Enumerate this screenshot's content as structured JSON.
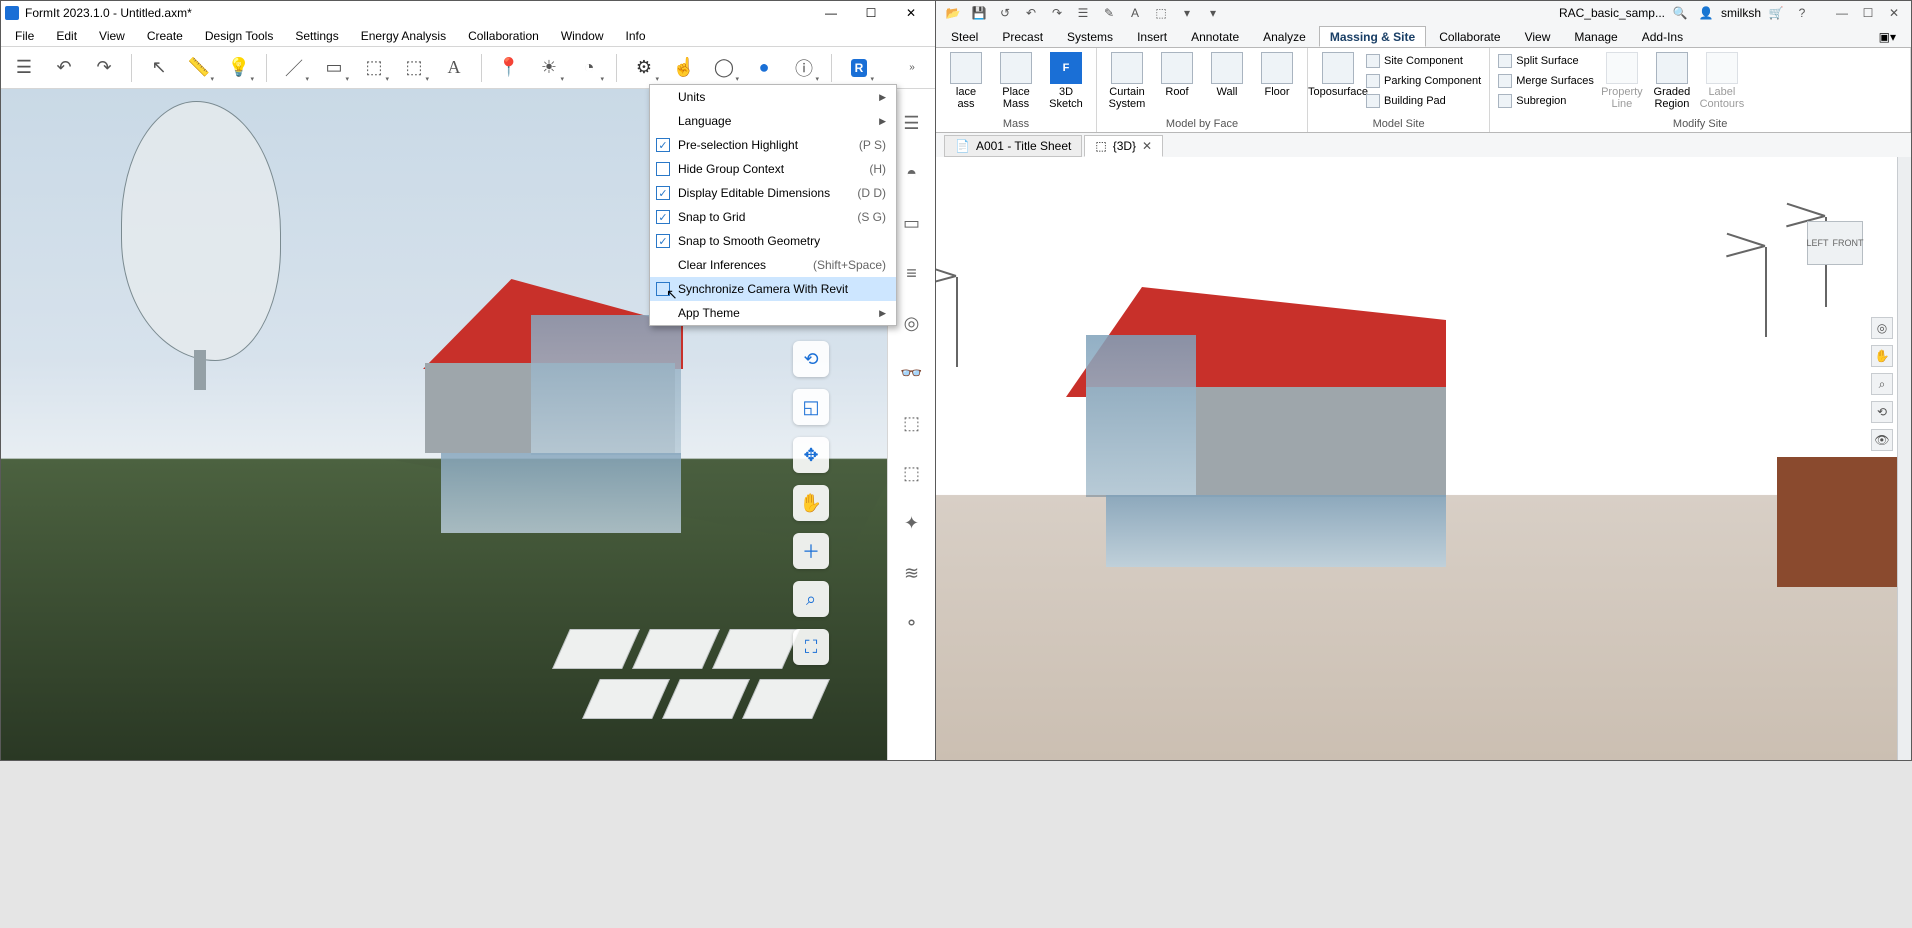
{
  "formit": {
    "title": "FormIt 2023.1.0 - Untitled.axm*",
    "menu": [
      "File",
      "Edit",
      "View",
      "Create",
      "Design Tools",
      "Settings",
      "Energy Analysis",
      "Collaboration",
      "Window",
      "Info"
    ],
    "dropdown": {
      "items": [
        {
          "label": "Units",
          "submenu": true
        },
        {
          "label": "Language",
          "submenu": true
        },
        {
          "label": "Pre-selection Highlight",
          "checked": true,
          "shortcut": "(P S)"
        },
        {
          "label": "Hide Group Context",
          "checked": false,
          "shortcut": "(H)"
        },
        {
          "label": "Display Editable Dimensions",
          "checked": true,
          "shortcut": "(D D)"
        },
        {
          "label": "Snap to Grid",
          "checked": true,
          "shortcut": "(S G)"
        },
        {
          "label": "Snap to Smooth Geometry",
          "checked": true
        },
        {
          "label": "Clear Inferences",
          "shortcut": "(Shift+Space)"
        },
        {
          "label": "Synchronize Camera With Revit",
          "checked": false,
          "highlight": true
        },
        {
          "label": "App Theme",
          "submenu": true
        }
      ]
    }
  },
  "revit": {
    "doc": "RAC_basic_samp...",
    "user": "smilksh",
    "tabs": [
      "Steel",
      "Precast",
      "Systems",
      "Insert",
      "Annotate",
      "Analyze",
      "Massing & Site",
      "Collaborate",
      "View",
      "Manage",
      "Add-Ins"
    ],
    "active_tab": "Massing & Site",
    "panels": {
      "mass_big": [
        [
          "place",
          "Place\nMass"
        ],
        [
          "3d",
          "3D\nSketch"
        ]
      ],
      "mass_title": "Mass",
      "face_big": [
        [
          "curtain",
          "Curtain\nSystem"
        ],
        [
          "roof",
          "Roof"
        ],
        [
          "wall",
          "Wall"
        ],
        [
          "floor",
          "Floor"
        ]
      ],
      "face_title": "Model by Face",
      "topo_big": [
        [
          "topo",
          "Toposurface"
        ]
      ],
      "site_items": [
        "Site Component",
        "Parking Component",
        "Building Pad"
      ],
      "site_title": "Model Site",
      "modify_right_big": [
        [
          "propline",
          "Property\nLine"
        ],
        [
          "graded",
          "Graded\nRegion"
        ],
        [
          "labelc",
          "Label\nContours"
        ]
      ],
      "modify_items": [
        "Split Surface",
        "Merge Surfaces",
        "Subregion"
      ],
      "modify_title": "Modify Site"
    },
    "view_tabs": [
      {
        "label": "A001 - Title Sheet",
        "active": false,
        "closable": false
      },
      {
        "label": "{3D}",
        "active": true,
        "closable": true
      }
    ],
    "viewcube": [
      "LEFT",
      "FRONT"
    ]
  }
}
